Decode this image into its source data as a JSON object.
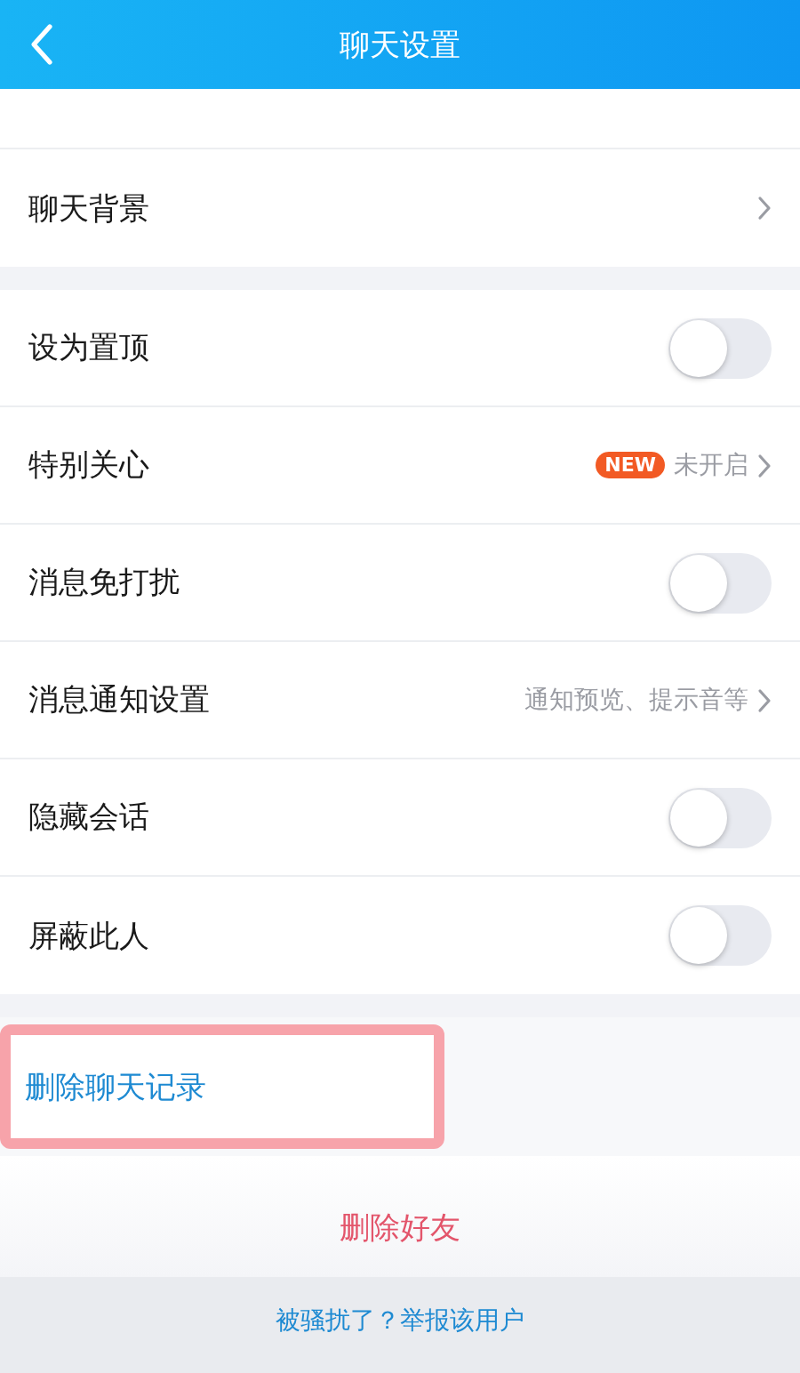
{
  "header": {
    "title": "聊天设置"
  },
  "sections": [
    {
      "rows": [
        {
          "kind": "link",
          "label": "聊天背景"
        }
      ]
    },
    {
      "rows": [
        {
          "kind": "toggle",
          "label": "设为置顶",
          "on": false
        },
        {
          "kind": "link",
          "label": "特别关心",
          "badge": "NEW",
          "value": "未开启"
        },
        {
          "kind": "toggle",
          "label": "消息免打扰",
          "on": false
        },
        {
          "kind": "link",
          "label": "消息通知设置",
          "value": "通知预览、提示音等"
        },
        {
          "kind": "toggle",
          "label": "隐藏会话",
          "on": false
        },
        {
          "kind": "toggle",
          "label": "屏蔽此人",
          "on": false
        }
      ]
    }
  ],
  "delete_history": {
    "label": "删除聊天记录",
    "highlighted": true
  },
  "delete_friend": "删除好友",
  "report_link": "被骚扰了？举报该用户"
}
